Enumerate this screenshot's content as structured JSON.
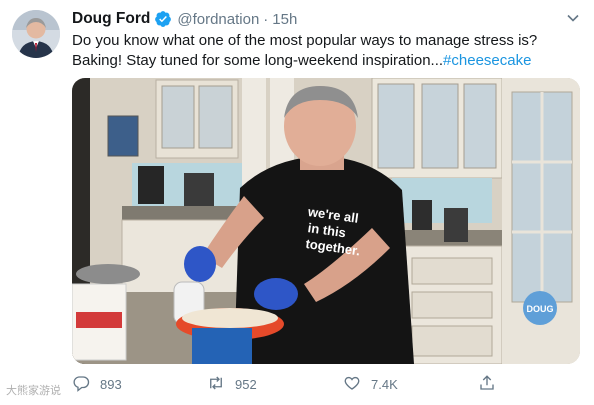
{
  "tweet": {
    "display_name": "Doug Ford",
    "handle": "@fordnation",
    "separator": "·",
    "time": "15h",
    "text_line1": "Do you know what one of the most popular ways to manage stress is?",
    "text_line2": "Baking! Stay tuned for some long-weekend inspiration...",
    "hashtag": "#cheesecake",
    "icons": {
      "verified": "verified-badge-icon",
      "caret": "chevron-down-icon"
    }
  },
  "media": {
    "shirt_text": [
      "we're all",
      "in this",
      "together."
    ],
    "corner_logo": "DOUG"
  },
  "actions": {
    "reply_count": "893",
    "retweet_count": "952",
    "like_count": "7.4K"
  },
  "watermark": {
    "text": "大熊家游说"
  },
  "colors": {
    "link": "#1b95e0",
    "secondary": "#657786",
    "verified": "#1da1f2"
  }
}
